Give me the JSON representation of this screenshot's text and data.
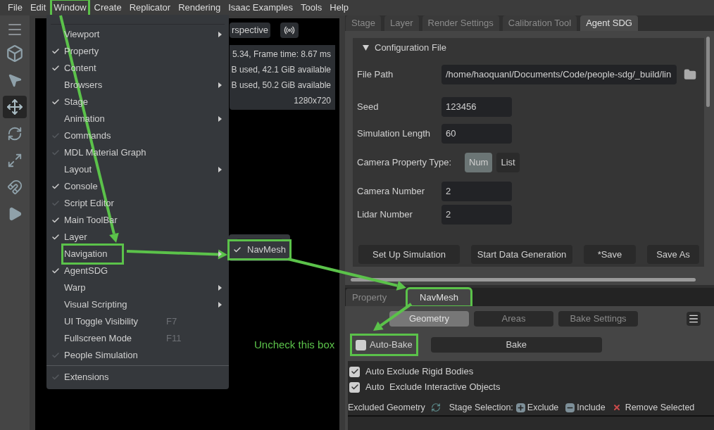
{
  "menubar": [
    {
      "label": "File",
      "highlighted": false
    },
    {
      "label": "Edit",
      "highlighted": false
    },
    {
      "label": "Window",
      "highlighted": true
    },
    {
      "label": "Create",
      "highlighted": false
    },
    {
      "label": "Replicator",
      "highlighted": false
    },
    {
      "label": "Rendering",
      "highlighted": false
    },
    {
      "label": "Isaac Examples",
      "highlighted": false
    },
    {
      "label": "Tools",
      "highlighted": false
    },
    {
      "label": "Help",
      "highlighted": false
    }
  ],
  "viewport": {
    "camera_button": "rspective",
    "stats": [
      "5.34, Frame time: 8.67 ms",
      "B used, 42.1 GiB available",
      "B used, 50.2 GiB available",
      "1280x720"
    ]
  },
  "window_menu": {
    "items": [
      {
        "label": "Viewport",
        "checked": false,
        "submenu": true,
        "highlighted": false,
        "separator_before": false
      },
      {
        "label": "Property",
        "checked": true,
        "faint": false,
        "submenu": false,
        "highlighted": false,
        "separator_before": false
      },
      {
        "label": "Content",
        "checked": true,
        "faint": false,
        "submenu": false,
        "highlighted": false,
        "separator_before": false
      },
      {
        "label": "Browsers",
        "checked": false,
        "submenu": true,
        "highlighted": false,
        "separator_before": false
      },
      {
        "label": "Stage",
        "checked": true,
        "faint": false,
        "submenu": false,
        "highlighted": false,
        "separator_before": false
      },
      {
        "label": "Animation",
        "checked": false,
        "submenu": true,
        "highlighted": false,
        "separator_before": false
      },
      {
        "label": "Commands",
        "checked": true,
        "faint": true,
        "submenu": false,
        "highlighted": false,
        "separator_before": false
      },
      {
        "label": "MDL Material Graph",
        "checked": true,
        "faint": true,
        "submenu": false,
        "highlighted": false,
        "separator_before": false
      },
      {
        "label": "Layout",
        "checked": false,
        "submenu": true,
        "highlighted": false,
        "separator_before": false
      },
      {
        "label": "Console",
        "checked": true,
        "faint": false,
        "submenu": false,
        "highlighted": false,
        "separator_before": false
      },
      {
        "label": "Script Editor",
        "checked": true,
        "faint": true,
        "submenu": false,
        "highlighted": false,
        "separator_before": false
      },
      {
        "label": "Main ToolBar",
        "checked": true,
        "faint": false,
        "submenu": false,
        "highlighted": false,
        "separator_before": false
      },
      {
        "label": "Layer",
        "checked": true,
        "faint": false,
        "submenu": false,
        "highlighted": false,
        "separator_before": false
      },
      {
        "label": "Navigation",
        "checked": false,
        "submenu": true,
        "highlighted": true,
        "separator_before": false
      },
      {
        "label": "AgentSDG",
        "checked": true,
        "faint": false,
        "submenu": false,
        "highlighted": false,
        "separator_before": false
      },
      {
        "label": "Warp",
        "checked": false,
        "submenu": true,
        "highlighted": false,
        "separator_before": false
      },
      {
        "label": "Visual Scripting",
        "checked": false,
        "submenu": true,
        "highlighted": false,
        "separator_before": false
      },
      {
        "label": "UI Toggle Visibility",
        "shortcut": "F7",
        "checked": false,
        "submenu": false,
        "highlighted": false,
        "separator_before": false
      },
      {
        "label": "Fullscreen Mode",
        "shortcut": "F11",
        "checked": false,
        "submenu": false,
        "highlighted": false,
        "separator_before": false
      },
      {
        "label": "People Simulation",
        "checked": true,
        "faint": true,
        "submenu": false,
        "highlighted": false,
        "separator_before": false
      },
      {
        "label": "Extensions",
        "checked": true,
        "faint": true,
        "submenu": false,
        "highlighted": false,
        "separator_before": true
      }
    ]
  },
  "navigation_submenu": {
    "items": [
      {
        "label": "NavMesh",
        "checked": true,
        "highlighted": true
      }
    ]
  },
  "agent_panel": {
    "tabs": [
      {
        "label": "Stage",
        "selected": false
      },
      {
        "label": "Layer",
        "selected": false
      },
      {
        "label": "Render Settings",
        "selected": false
      },
      {
        "label": "Calibration Tool",
        "selected": false
      },
      {
        "label": "Agent SDG",
        "selected": true
      }
    ],
    "section": {
      "title": "Configuration File",
      "expanded": true,
      "fields": [
        {
          "kind": "path",
          "label": "File Path",
          "value": "/home/haoquanl/Documents/Code/people-sdg/_build/lin"
        },
        {
          "kind": "text",
          "label": "Seed",
          "value": "123456"
        },
        {
          "kind": "text",
          "label": "Simulation Length",
          "value": "60"
        },
        {
          "kind": "toggle",
          "label": "Camera Property Type:",
          "options": [
            {
              "label": "Num",
              "selected": true
            },
            {
              "label": "List",
              "selected": false
            }
          ]
        },
        {
          "kind": "text",
          "label": "Camera Number",
          "value": "2"
        },
        {
          "kind": "text",
          "label": "Lidar Number",
          "value": "2"
        }
      ],
      "buttons": [
        "Set Up Simulation",
        "Start Data Generation",
        "*Save",
        "Save As"
      ]
    }
  },
  "navmesh_panel": {
    "tabs": [
      {
        "label": "Property",
        "selected": false,
        "highlighted": false
      },
      {
        "label": "NavMesh",
        "selected": true,
        "highlighted": true
      }
    ],
    "subtabs": [
      {
        "label": "Geometry",
        "selected": true
      },
      {
        "label": "Areas",
        "selected": false
      },
      {
        "label": "Bake Settings",
        "selected": false
      }
    ],
    "auto_bake": {
      "label": "Auto-Bake",
      "checked": false,
      "highlighted": true
    },
    "bake_button": "Bake",
    "options": [
      {
        "label": "Auto Exclude Rigid Bodies",
        "checked": true
      },
      {
        "label": "Auto  Exclude Interactive Objects",
        "checked": true
      }
    ],
    "excluded_geometry": {
      "label": "Excluded Geometry",
      "stage_selection": "Stage Selection:",
      "actions": [
        {
          "kind": "plus",
          "label": "Exclude"
        },
        {
          "kind": "minus",
          "label": "Include"
        },
        {
          "kind": "remove",
          "label": "Remove Selected"
        }
      ]
    }
  },
  "annotation": {
    "note": "Uncheck this box"
  }
}
